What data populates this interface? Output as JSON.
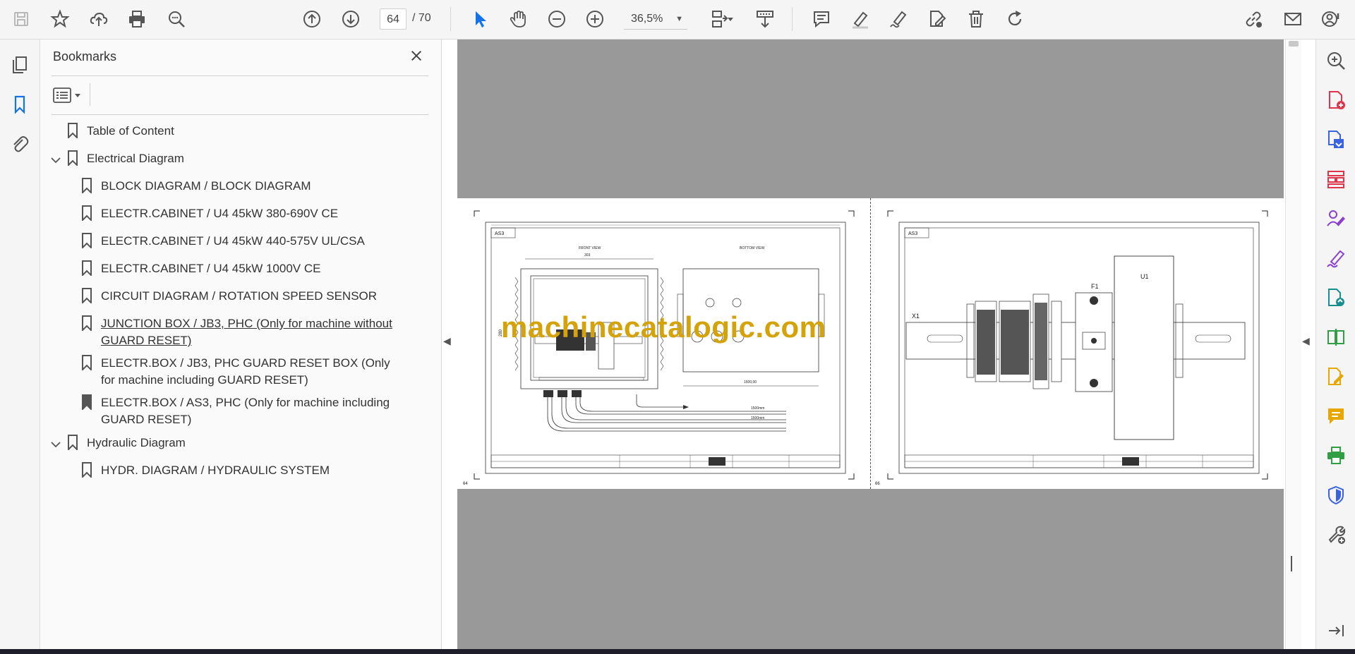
{
  "toolbar": {
    "page_current": "64",
    "page_total": "/  70",
    "zoom": "36,5%",
    "icons": [
      "save-icon",
      "star-icon",
      "cloud-upload-icon",
      "print-icon",
      "zoom-search-icon",
      "page-up-icon",
      "page-down-icon",
      "select-arrow-icon",
      "hand-icon",
      "zoom-out-icon",
      "zoom-in-icon",
      "zoom-dropdown-icon",
      "page-fit-icon",
      "scroll-mode-icon",
      "comment-icon",
      "highlight-icon",
      "sign-icon",
      "edit-pdf-icon",
      "delete-icon",
      "rotate-icon",
      "share-link-icon",
      "mail-icon",
      "account-icon"
    ]
  },
  "bookmarks": {
    "title": "Bookmarks",
    "items": [
      {
        "label": "Table of Content"
      },
      {
        "label": "Electrical Diagram"
      },
      {
        "label": "BLOCK DIAGRAM / BLOCK DIAGRAM"
      },
      {
        "label": "ELECTR.CABINET / U4 45kW 380-690V CE"
      },
      {
        "label": "ELECTR.CABINET / U4 45kW 440-575V UL/CSA"
      },
      {
        "label": "ELECTR.CABINET / U4 45kW 1000V CE"
      },
      {
        "label": "CIRCUIT DIAGRAM / ROTATION SPEED SENSOR"
      },
      {
        "label": "JUNCTION BOX / JB3, PHC (Only for machine without GUARD RESET)"
      },
      {
        "label": "ELECTR.BOX / JB3, PHC GUARD RESET BOX (Only for machine including GUARD RESET)"
      },
      {
        "label": "ELECTR.BOX / AS3, PHC (Only for machine including GUARD RESET)"
      },
      {
        "label": "Hydraulic Diagram"
      },
      {
        "label": "HYDR. DIAGRAM / HYDRAULIC SYSTEM"
      }
    ]
  },
  "document": {
    "watermark": "machinecatalogic.com",
    "left_page": {
      "tag": "AS3",
      "front_view": "FRONT VIEW",
      "bottom_view": "BOTTOM VIEW",
      "width_label": "303",
      "height_label": "280",
      "length_label": "1500,00",
      "cable_a": "1500mm",
      "cable_b": "1500mm",
      "page_no": "64"
    },
    "right_page": {
      "tag": "AS3",
      "label_x1": "X1",
      "label_f1": "F1",
      "label_u1": "U1",
      "page_no": "66"
    }
  },
  "colors": {
    "accent_blue": "#1473e6",
    "watermark": "#d4a20a",
    "canvas_gray": "#999999"
  }
}
